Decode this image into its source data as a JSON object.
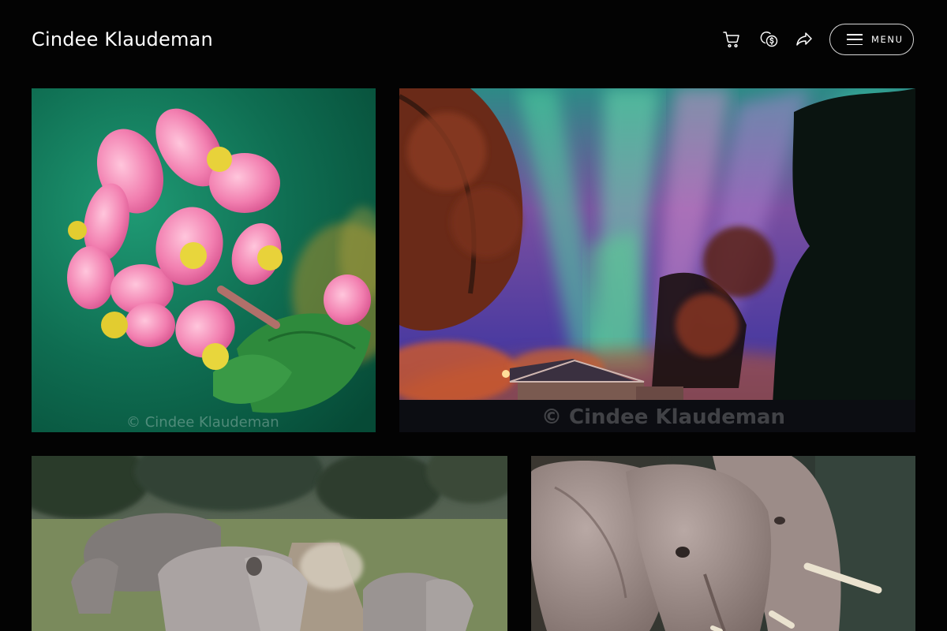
{
  "site": {
    "title": "Cindee Klaudeman"
  },
  "header": {
    "icons": [
      "cart-icon",
      "coin-dollar-icon",
      "share-icon"
    ],
    "menu_label": "MENU"
  },
  "gallery": {
    "tiles": [
      {
        "subject": "pink-begonia-flower",
        "watermark": "© Cindee Klaudeman"
      },
      {
        "subject": "northern-lights-over-houses",
        "watermark": "© Cindee Klaudeman"
      },
      {
        "subject": "rhinoceros-family-on-road",
        "watermark": ""
      },
      {
        "subject": "african-elephants",
        "watermark": ""
      }
    ]
  },
  "colors": {
    "background": "#030303",
    "text": "#ffffff",
    "menu_border": "#d8d8d8"
  }
}
